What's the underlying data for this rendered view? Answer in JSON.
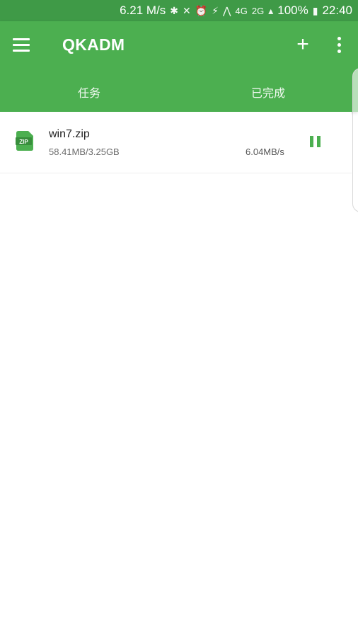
{
  "status_bar": {
    "network_speed": "6.21 M/s",
    "icons": [
      "bluetooth-icon",
      "mute-icon",
      "alarm-icon",
      "data-saver-icon",
      "wifi-icon",
      "4g-signal-icon"
    ],
    "signal_label_top": "4G",
    "signal_label_bottom": "2G",
    "battery": "100%",
    "time": "22:40"
  },
  "app_bar": {
    "title": "QKADM",
    "menu_icon": "hamburger-menu-icon",
    "add_icon": "plus-icon",
    "more_icon": "more-vert-icon",
    "add_glyph": "+"
  },
  "tabs": [
    {
      "label": "任务",
      "selected": true
    },
    {
      "label": "已完成",
      "selected": false
    }
  ],
  "downloads": [
    {
      "file_name": "win7.zip",
      "file_type_badge": "ZIP",
      "progress_text": "58.41MB/3.25GB",
      "speed": "6.04MB/s",
      "state": "downloading"
    }
  ],
  "colors": {
    "primary": "#4caf50",
    "status_bar": "#3f9a47"
  }
}
